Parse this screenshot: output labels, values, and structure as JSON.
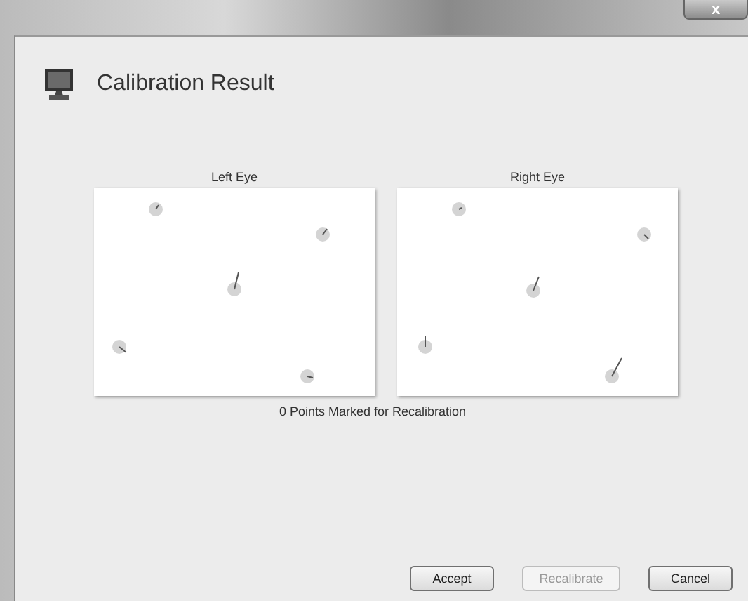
{
  "window": {
    "close": "x"
  },
  "header": {
    "title": "Calibration Result"
  },
  "plots": [
    {
      "label": "Left Eye"
    },
    {
      "label": "Right Eye"
    }
  ],
  "status": "0 Points Marked for Recalibration",
  "buttons": [
    {
      "label": "Accept",
      "disabled": false
    },
    {
      "label": "Recalibrate",
      "disabled": true
    },
    {
      "label": "Cancel",
      "disabled": false
    }
  ]
}
